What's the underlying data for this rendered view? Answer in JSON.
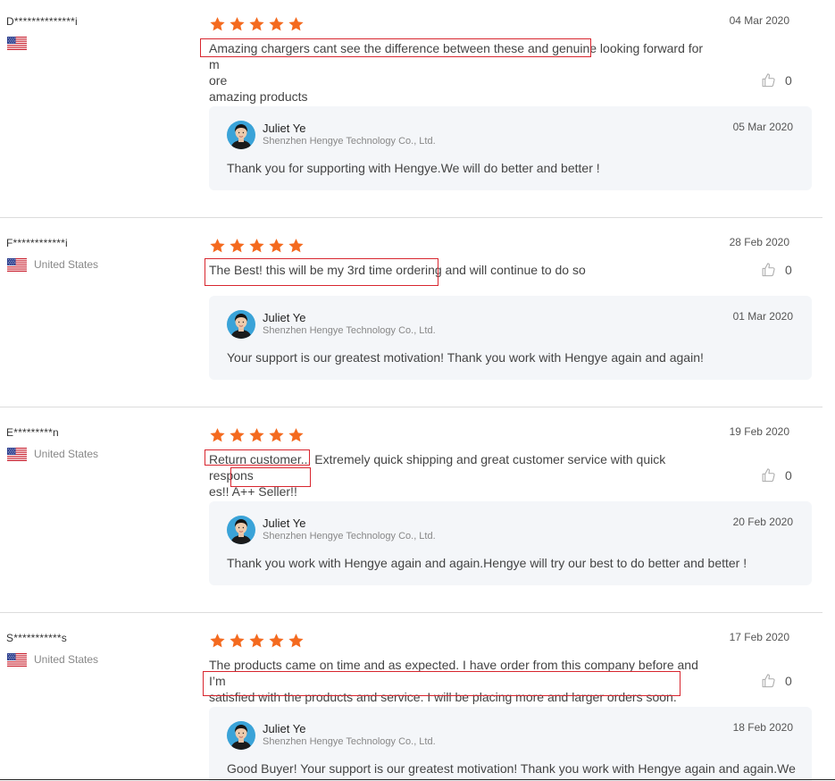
{
  "colors": {
    "star": "#f46a1f",
    "highlight_box": "#d8262f",
    "divider": "#dcdcdc",
    "reply_bg": "#f4f6f9"
  },
  "icons": {
    "rating_star": "star-icon",
    "like": "thumbs-up-icon",
    "flag": "us-flag-icon",
    "avatar": "seller-avatar-icon"
  },
  "seller": {
    "name": "Juliet Ye",
    "company": "Shenzhen Hengye Technology Co., Ltd."
  },
  "reviews": [
    {
      "user": "D**************i",
      "country": "",
      "rating": 5,
      "date": "04 Mar 2020",
      "text_lines": [
        "Amazing chargers cant see the difference between these and genuine looking forward for m",
        "ore",
        "amazing products"
      ],
      "likes": "0",
      "reply": {
        "date": "05 Mar 2020",
        "text": "Thank you for supporting with Hengye.We will do better and better !"
      }
    },
    {
      "user": "F************i",
      "country": "United States",
      "rating": 5,
      "date": "28 Feb 2020",
      "text_lines": [
        "The Best! this will be my 3rd time ordering and will continue to do so"
      ],
      "likes": "0",
      "reply": {
        "date": "01 Mar 2020",
        "text": "Your support is our greatest motivation! Thank you work with Hengye again and again!"
      }
    },
    {
      "user": "E*********n",
      "country": "United States",
      "rating": 5,
      "date": "19 Feb 2020",
      "text_lines": [
        "Return customer... Extremely quick shipping and great customer service with quick respons",
        "es!! A++ Seller!!"
      ],
      "likes": "0",
      "reply": {
        "date": "20 Feb 2020",
        "text": "Thank you work with Hengye again and again.Hengye will try our best to do better and better !"
      }
    },
    {
      "user": "S***********s",
      "country": "United States",
      "rating": 5,
      "date": "17 Feb 2020",
      "text_lines": [
        "The products came on time and as expected. I have order from this company before and I’m",
        "satisfied with the products and service. I will be placing more and larger orders soon."
      ],
      "likes": "0",
      "reply": {
        "date": "18 Feb 2020",
        "text": "Good Buyer! Your support is our greatest motivation! Thank you work with Hengye again and again.We w"
      }
    }
  ]
}
